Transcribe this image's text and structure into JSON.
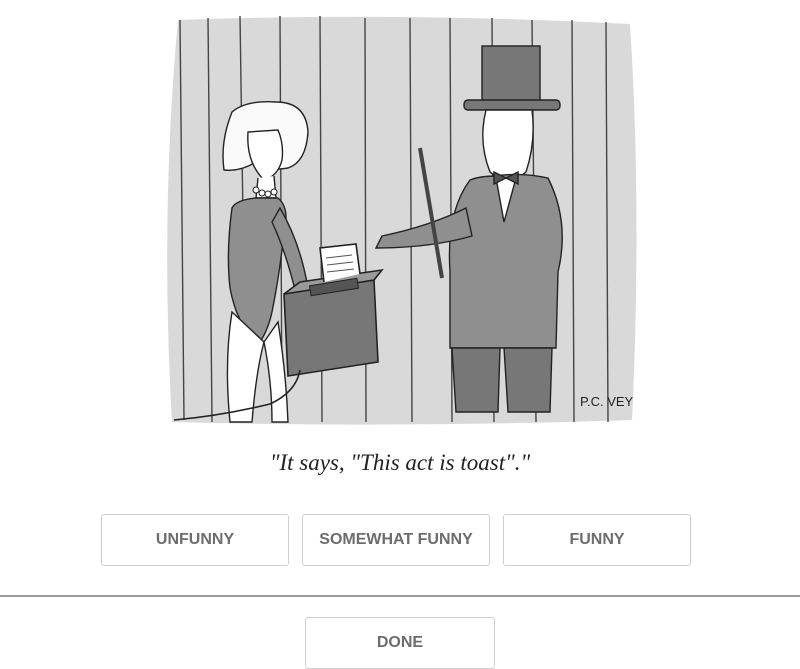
{
  "cartoon": {
    "signature": "P.C. VEY"
  },
  "caption": "\"It says, \"This act is toast\".\"",
  "rating": {
    "unfunny_label": "UNFUNNY",
    "somewhat_label": "SOMEWHAT FUNNY",
    "funny_label": "FUNNY"
  },
  "done_label": "DONE"
}
